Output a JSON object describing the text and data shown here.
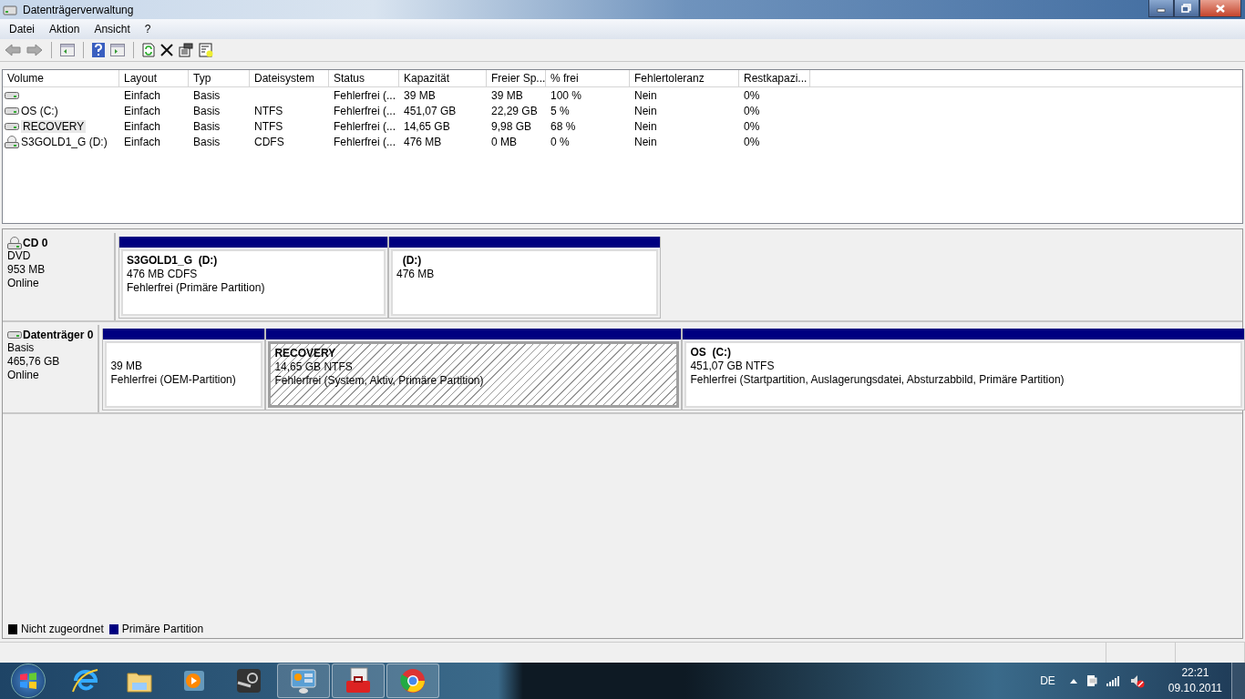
{
  "window": {
    "title": "Datenträgerverwaltung"
  },
  "menu": [
    {
      "label": "Datei"
    },
    {
      "label": "Aktion"
    },
    {
      "label": "Ansicht"
    },
    {
      "label": "?"
    }
  ],
  "table": {
    "columns": [
      "Volume",
      "Layout",
      "Typ",
      "Dateisystem",
      "Status",
      "Kapazität",
      "Freier Sp...",
      "% frei",
      "Fehlertoleranz",
      "Restkapazi..."
    ],
    "rows": [
      {
        "kind": "disk",
        "selected": false,
        "cells": [
          "",
          "Einfach",
          "Basis",
          "",
          "Fehlerfrei (...",
          "39 MB",
          "39 MB",
          "100 %",
          "Nein",
          "0%"
        ]
      },
      {
        "kind": "disk",
        "selected": false,
        "cells": [
          "OS (C:)",
          "Einfach",
          "Basis",
          "NTFS",
          "Fehlerfrei (...",
          "451,07 GB",
          "22,29 GB",
          "5 %",
          "Nein",
          "0%"
        ]
      },
      {
        "kind": "disk",
        "selected": true,
        "cells": [
          "RECOVERY",
          "Einfach",
          "Basis",
          "NTFS",
          "Fehlerfrei (...",
          "14,65 GB",
          "9,98 GB",
          "68 %",
          "Nein",
          "0%"
        ]
      },
      {
        "kind": "cd",
        "selected": false,
        "cells": [
          "S3GOLD1_G (D:)",
          "Einfach",
          "Basis",
          "CDFS",
          "Fehlerfrei (...",
          "476 MB",
          "0 MB",
          "0 %",
          "Nein",
          "0%"
        ]
      }
    ]
  },
  "disks": [
    {
      "kind": "cd",
      "name": "CD 0",
      "type": "DVD",
      "size": "953 MB",
      "status": "Online",
      "partitions": [
        {
          "label": "S3GOLD1_G  (D:)",
          "size": "476 MB CDFS",
          "status": "Fehlerfrei (Primäre Partition)",
          "selected": false
        },
        {
          "label": "  (D:)",
          "size": "476 MB",
          "selected": false
        }
      ]
    },
    {
      "kind": "disk",
      "name": "Datenträger 0",
      "type": "Basis",
      "size": "465,76 GB",
      "status": "Online",
      "partitions": [
        {
          "size": "39 MB",
          "status": "Fehlerfrei (OEM-Partition)",
          "selected": false
        },
        {
          "label": "RECOVERY",
          "size": "14,65 GB NTFS",
          "status": "Fehlerfrei (System, Aktiv, Primäre Partition)",
          "selected": true
        },
        {
          "label": "OS  (C:)",
          "size": "451,07 GB NTFS",
          "status": "Fehlerfrei (Startpartition, Auslagerungsdatei, Absturzabbild, Primäre Partition)",
          "selected": false
        }
      ]
    }
  ],
  "legend": [
    {
      "label": "Nicht zugeordnet",
      "color": "#000000"
    },
    {
      "label": "Primäre Partition",
      "color": "#000080"
    }
  ],
  "taskbar": {
    "items": [
      {
        "kind": "ie",
        "running": false
      },
      {
        "kind": "folder",
        "running": false
      },
      {
        "kind": "media",
        "running": false
      },
      {
        "kind": "steam",
        "running": false
      },
      {
        "kind": "panel",
        "running": true
      },
      {
        "kind": "toolbox",
        "running": true
      },
      {
        "kind": "chrome",
        "running": true
      }
    ],
    "language": "DE",
    "time": "22:21",
    "date": "09.10.2011"
  }
}
